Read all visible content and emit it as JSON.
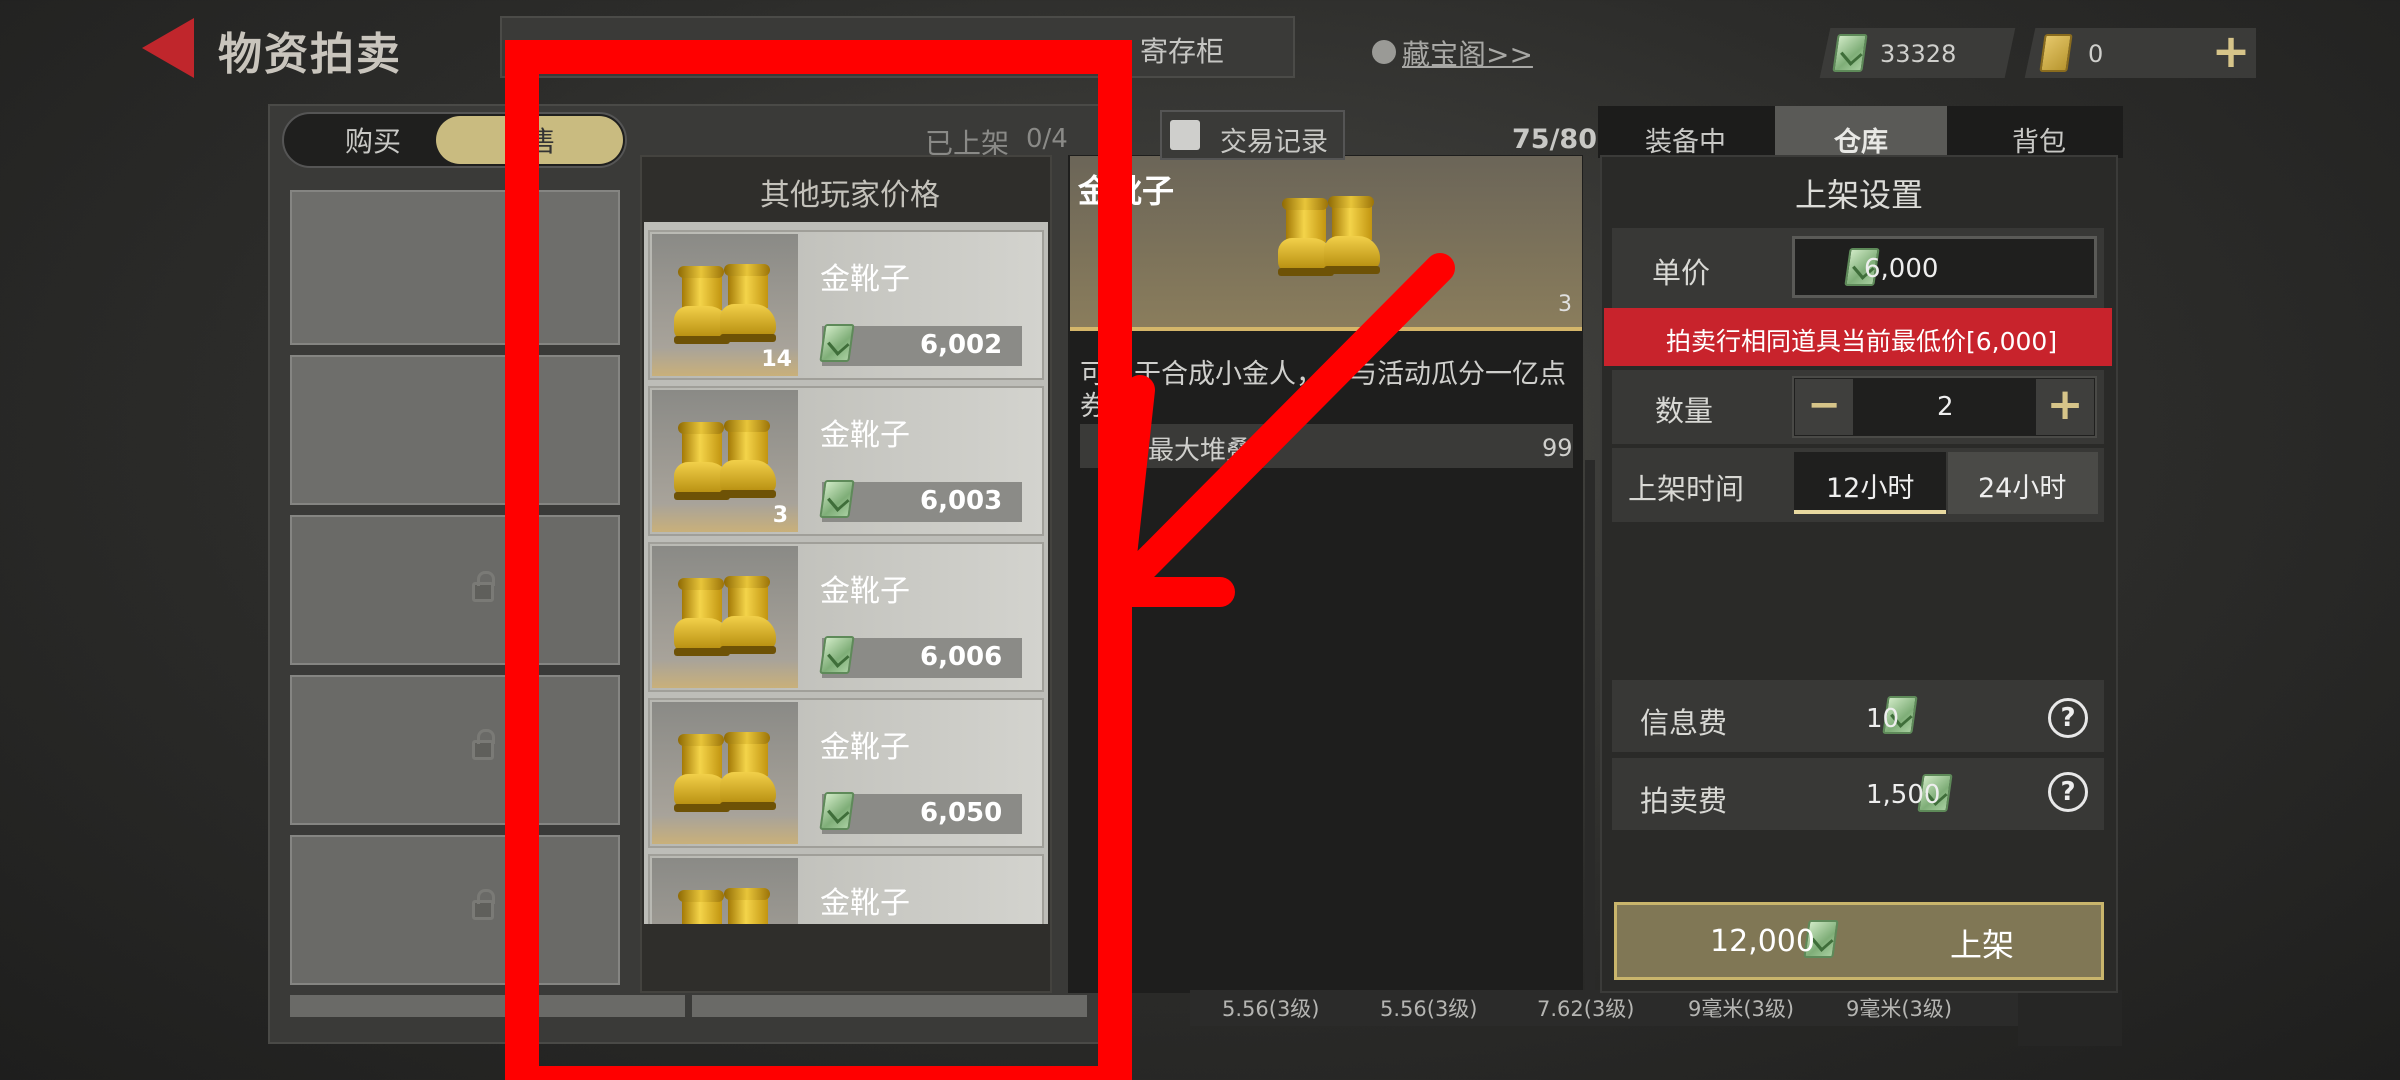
{
  "header": {
    "title": "物资拍卖",
    "tab_locker": "寄存柜",
    "treasure_link": "藏宝阁>>",
    "cash_amount": "33328",
    "coupon_amount": "0"
  },
  "left_panel": {
    "tab_buy": "购买",
    "tab_sell": "售",
    "listed_label": "已上架",
    "listed_count": "0/4"
  },
  "popup_other_prices": {
    "title": "其他玩家价格",
    "items": [
      {
        "name": "金靴子",
        "count": "14",
        "price": "6,002"
      },
      {
        "name": "金靴子",
        "count": "3",
        "price": "6,003"
      },
      {
        "name": "金靴子",
        "count": "",
        "price": "6,006"
      },
      {
        "name": "金靴子",
        "count": "",
        "price": "6,050"
      },
      {
        "name": "金靴子",
        "count": "",
        "price": ""
      }
    ]
  },
  "item_detail": {
    "name": "金靴子",
    "count": "3",
    "desc_line1": "可用于合成小金人，参与活动瓜分一亿点",
    "desc_line2": "券。",
    "stack_label": "最大堆叠",
    "stack_value": "99"
  },
  "inventory": {
    "trade_record": "交易记录",
    "capacity": "75/80",
    "tab_equipped": "装备中",
    "tab_warehouse": "仓库",
    "tab_backpack": "背包",
    "ammo_labels": [
      "5.56(3级)",
      "5.56(3级)",
      "7.62(3级)",
      "9毫米(3级)",
      "9毫米(3级)"
    ]
  },
  "listing_settings": {
    "title": "上架设置",
    "unit_price_label": "单价",
    "unit_price": "6,000",
    "lowest_notice": "拍卖行相同道具当前最低价[6,000]",
    "quantity_label": "数量",
    "quantity": "2",
    "duration_label": "上架时间",
    "duration_12": "12小时",
    "duration_24": "24小时",
    "info_fee_label": "信息费",
    "info_fee": "10",
    "auction_fee_label": "拍卖费",
    "auction_fee": "1,500",
    "total": "12,000",
    "submit_label": "上架"
  },
  "colors": {
    "annotation_red": "#ff0000",
    "gold": "#d8c37a",
    "notice_red": "#c8232c"
  }
}
